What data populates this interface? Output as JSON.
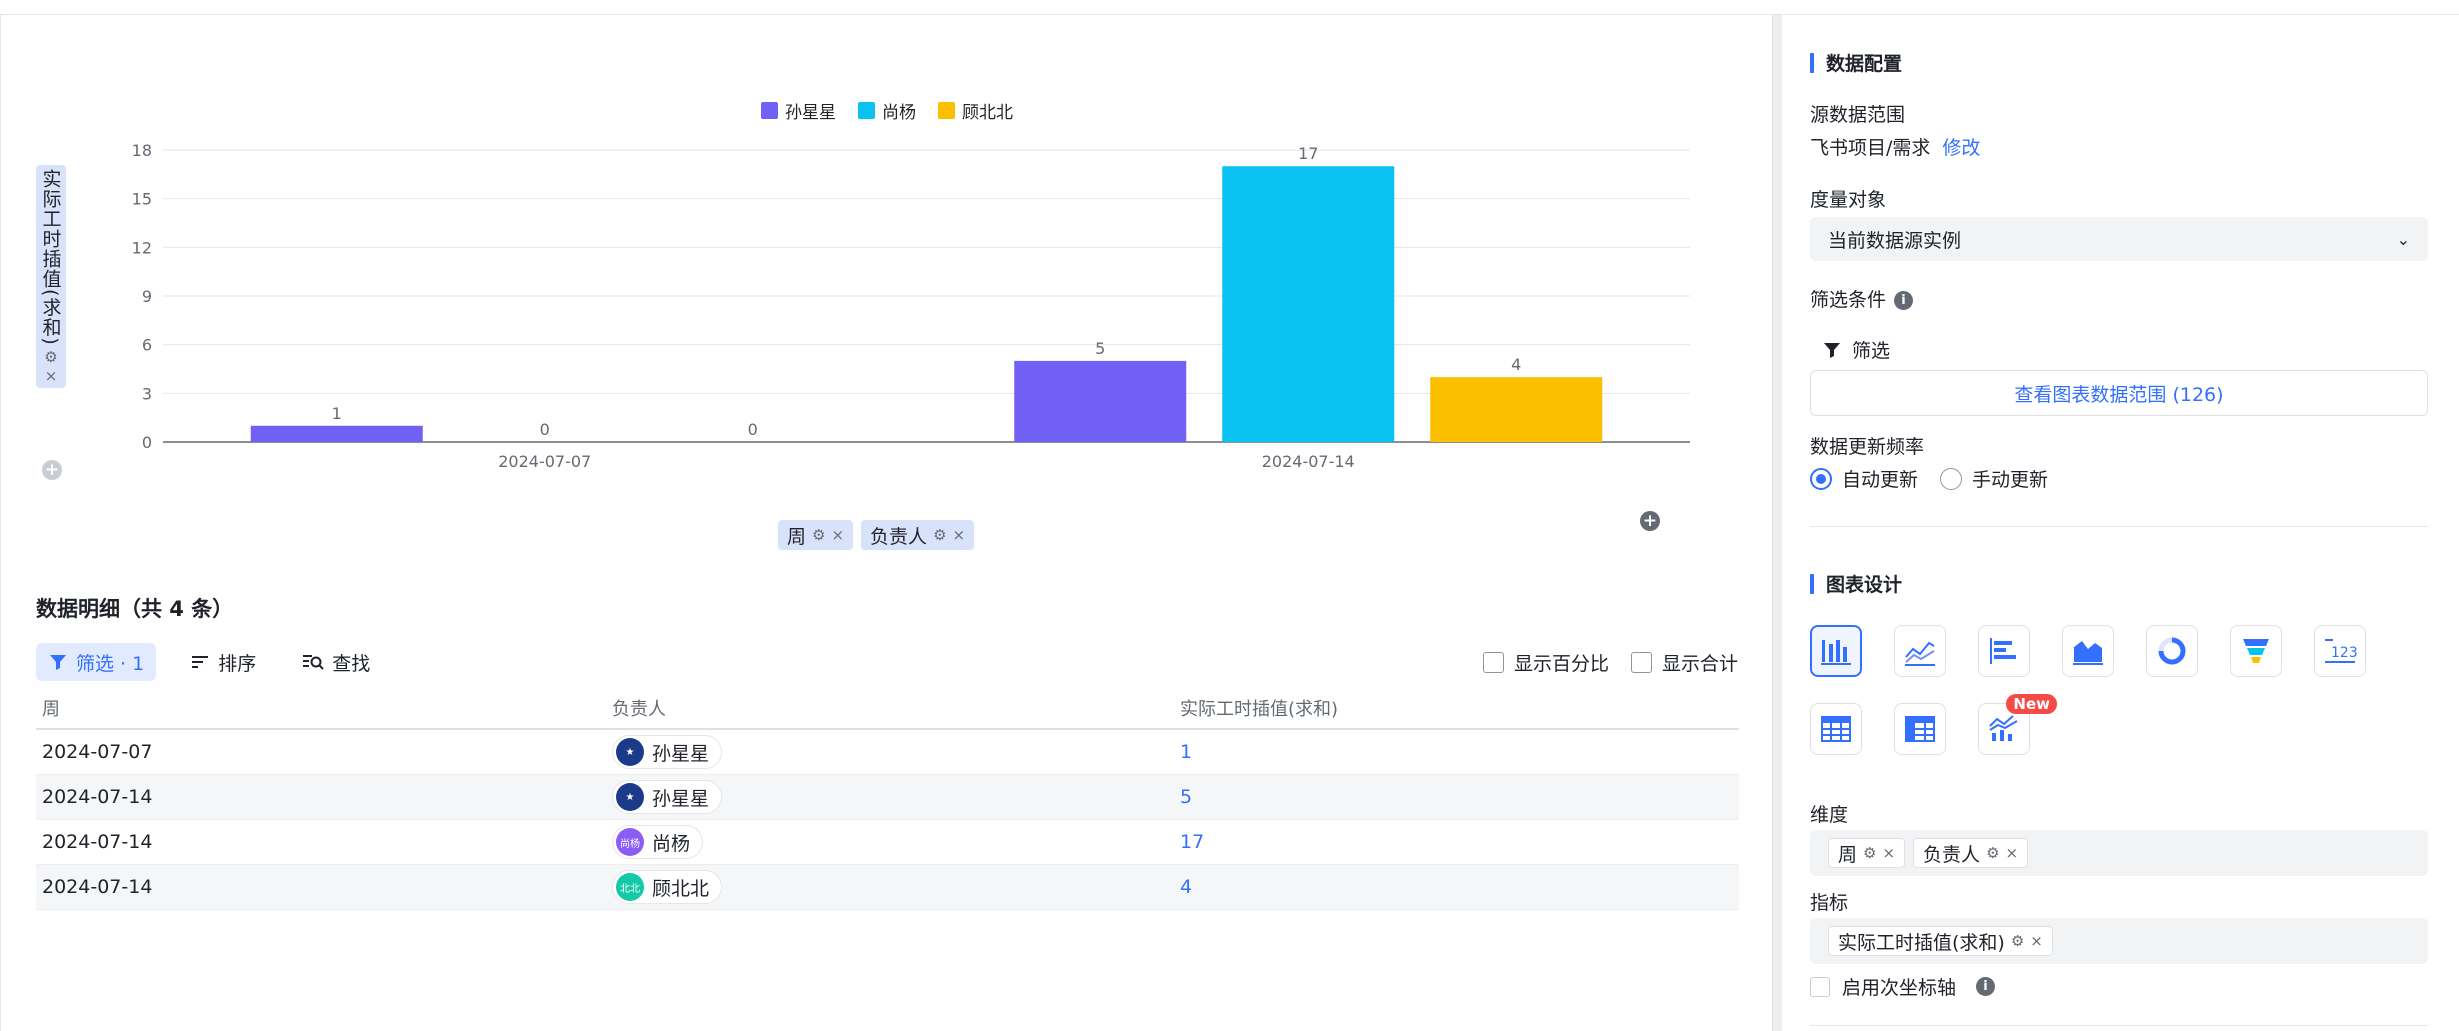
{
  "chart_data": {
    "type": "bar",
    "categories": [
      "2024-07-07",
      "2024-07-14"
    ],
    "series": [
      {
        "name": "孙星星",
        "color": "#7160f4",
        "values": [
          1,
          5
        ]
      },
      {
        "name": "尚杨",
        "color": "#09c2f2",
        "values": [
          0,
          17
        ]
      },
      {
        "name": "顾北北",
        "color": "#fbbf00",
        "values": [
          0,
          4
        ]
      }
    ],
    "ylabel": "实际工时插值(求和)",
    "ylim": [
      0,
      18
    ],
    "yticks": [
      0,
      3,
      6,
      9,
      12,
      15,
      18
    ],
    "grid": true,
    "legend_position": "top-center",
    "data_labels": true
  },
  "chart_axis": {
    "y_chip_icons": {
      "gear": "⚙",
      "close": "×"
    },
    "dimension_chips": [
      {
        "label": "周"
      },
      {
        "label": "负责人"
      }
    ]
  },
  "detail": {
    "title": "数据明细（共 4 条）",
    "toolbar": {
      "filter_label": "筛选 · 1",
      "sort_label": "排序",
      "find_label": "查找",
      "show_percent_label": "显示百分比",
      "show_total_label": "显示合计"
    },
    "columns": [
      "周",
      "负责人",
      "实际工时插值(求和)"
    ],
    "rows": [
      {
        "week": "2024-07-07",
        "owner": "孙星星",
        "avatar_text": "★",
        "avatar_color": "#1b3a8a",
        "value": "1"
      },
      {
        "week": "2024-07-14",
        "owner": "孙星星",
        "avatar_text": "★",
        "avatar_color": "#1b3a8a",
        "value": "5"
      },
      {
        "week": "2024-07-14",
        "owner": "尚杨",
        "avatar_text": "尚杨",
        "avatar_color": "#8b5cf6",
        "value": "17"
      },
      {
        "week": "2024-07-14",
        "owner": "顾北北",
        "avatar_text": "北北",
        "avatar_color": "#14c9a7",
        "value": "4"
      }
    ]
  },
  "panel": {
    "data_config_title": "数据配置",
    "source_range_label": "源数据范围",
    "source_range_value": "飞书项目/需求",
    "modify_link": "修改",
    "measure_label": "度量对象",
    "measure_value": "当前数据源实例",
    "filter_cond_label": "筛选条件",
    "filter_button": "筛选",
    "view_range_button": "查看图表数据范围 (126)",
    "refresh_label": "数据更新频率",
    "auto_update": "自动更新",
    "manual_update": "手动更新",
    "chart_design_title": "图表设计",
    "new_badge": "New",
    "dimension_label": "维度",
    "dimension_chips": [
      "周",
      "负责人"
    ],
    "metric_label": "指标",
    "metric_chips": [
      "实际工时插值(求和)"
    ],
    "secondary_axis_label": "启用次坐标轴"
  }
}
